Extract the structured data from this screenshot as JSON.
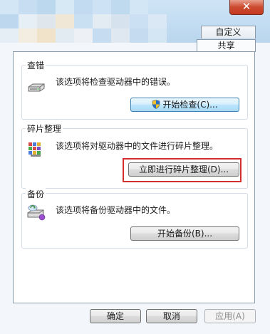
{
  "window": {
    "close_glyph": "✕"
  },
  "tabs": {
    "custom": "自定义",
    "share": "共享"
  },
  "check": {
    "label": "查错",
    "description": "该选项将检查驱动器中的错误。",
    "button": "开始检查(C)...",
    "icon": "drive-icon"
  },
  "defrag": {
    "label": "碎片整理",
    "description": "该选项将对驱动器中的文件进行碎片整理。",
    "button": "立即进行碎片整理(D)...",
    "icon": "defrag-icon"
  },
  "backup": {
    "label": "备份",
    "description": "该选项将备份驱动器中的文件。",
    "button": "开始备份(B)...",
    "icon": "backup-icon"
  },
  "footer": {
    "ok": "确定",
    "cancel": "取消",
    "apply": "应用(A)"
  },
  "colors": {
    "highlight": "#d32f2f",
    "shield": "#2a6ebd",
    "close": "#c43b22"
  }
}
